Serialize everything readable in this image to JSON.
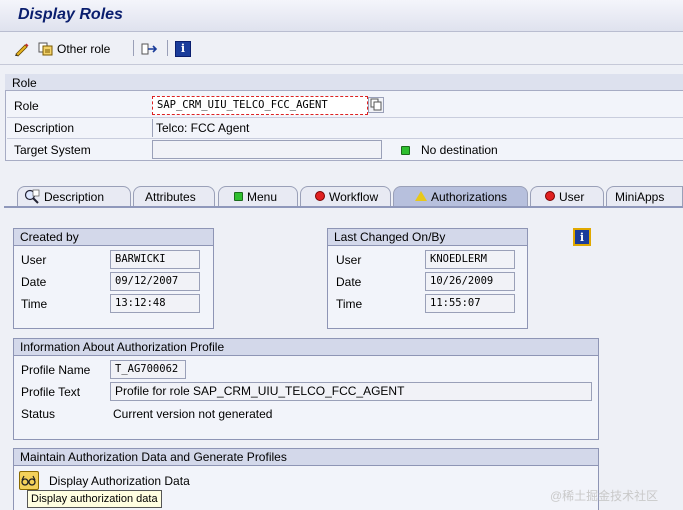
{
  "window": {
    "title": "Display Roles"
  },
  "toolbar": {
    "other_role_label": "Other role"
  },
  "role_group": {
    "heading": "Role",
    "role_label": "Role",
    "role_value": "SAP_CRM_UIU_TELCO_FCC_AGENT",
    "description_label": "Description",
    "description_value": "Telco: FCC Agent",
    "target_system_label": "Target System",
    "target_system_value": "",
    "destination_status": "No destination"
  },
  "tabs": [
    {
      "label": "Description",
      "icon": "description-icon"
    },
    {
      "label": "Attributes",
      "icon": ""
    },
    {
      "label": "Menu",
      "icon": "green-status-icon"
    },
    {
      "label": "Workflow",
      "icon": "red-status-icon"
    },
    {
      "label": "Authorizations",
      "icon": "warning-icon",
      "active": true
    },
    {
      "label": "User",
      "icon": "red-status-icon"
    },
    {
      "label": "MiniApps",
      "icon": ""
    }
  ],
  "created_by": {
    "heading": "Created by",
    "user_label": "User",
    "user_value": "BARWICKI",
    "date_label": "Date",
    "date_value": "09/12/2007",
    "time_label": "Time",
    "time_value": "13:12:48"
  },
  "last_changed": {
    "heading": "Last Changed On/By",
    "user_label": "User",
    "user_value": "KNOEDLERM",
    "date_label": "Date",
    "date_value": "10/26/2009",
    "time_label": "Time",
    "time_value": "11:55:07"
  },
  "auth_profile": {
    "heading": "Information About Authorization Profile",
    "profile_name_label": "Profile Name",
    "profile_name_value": "T_AG700062",
    "profile_text_label": "Profile Text",
    "profile_text_value": "Profile for role SAP_CRM_UIU_TELCO_FCC_AGENT",
    "status_label": "Status",
    "status_value": "Current version not generated"
  },
  "maintain": {
    "heading": "Maintain Authorization Data and Generate Profiles",
    "button_label": "Display Authorization Data",
    "tooltip": "Display authorization data"
  },
  "watermark": "@稀土掘金技术社区"
}
